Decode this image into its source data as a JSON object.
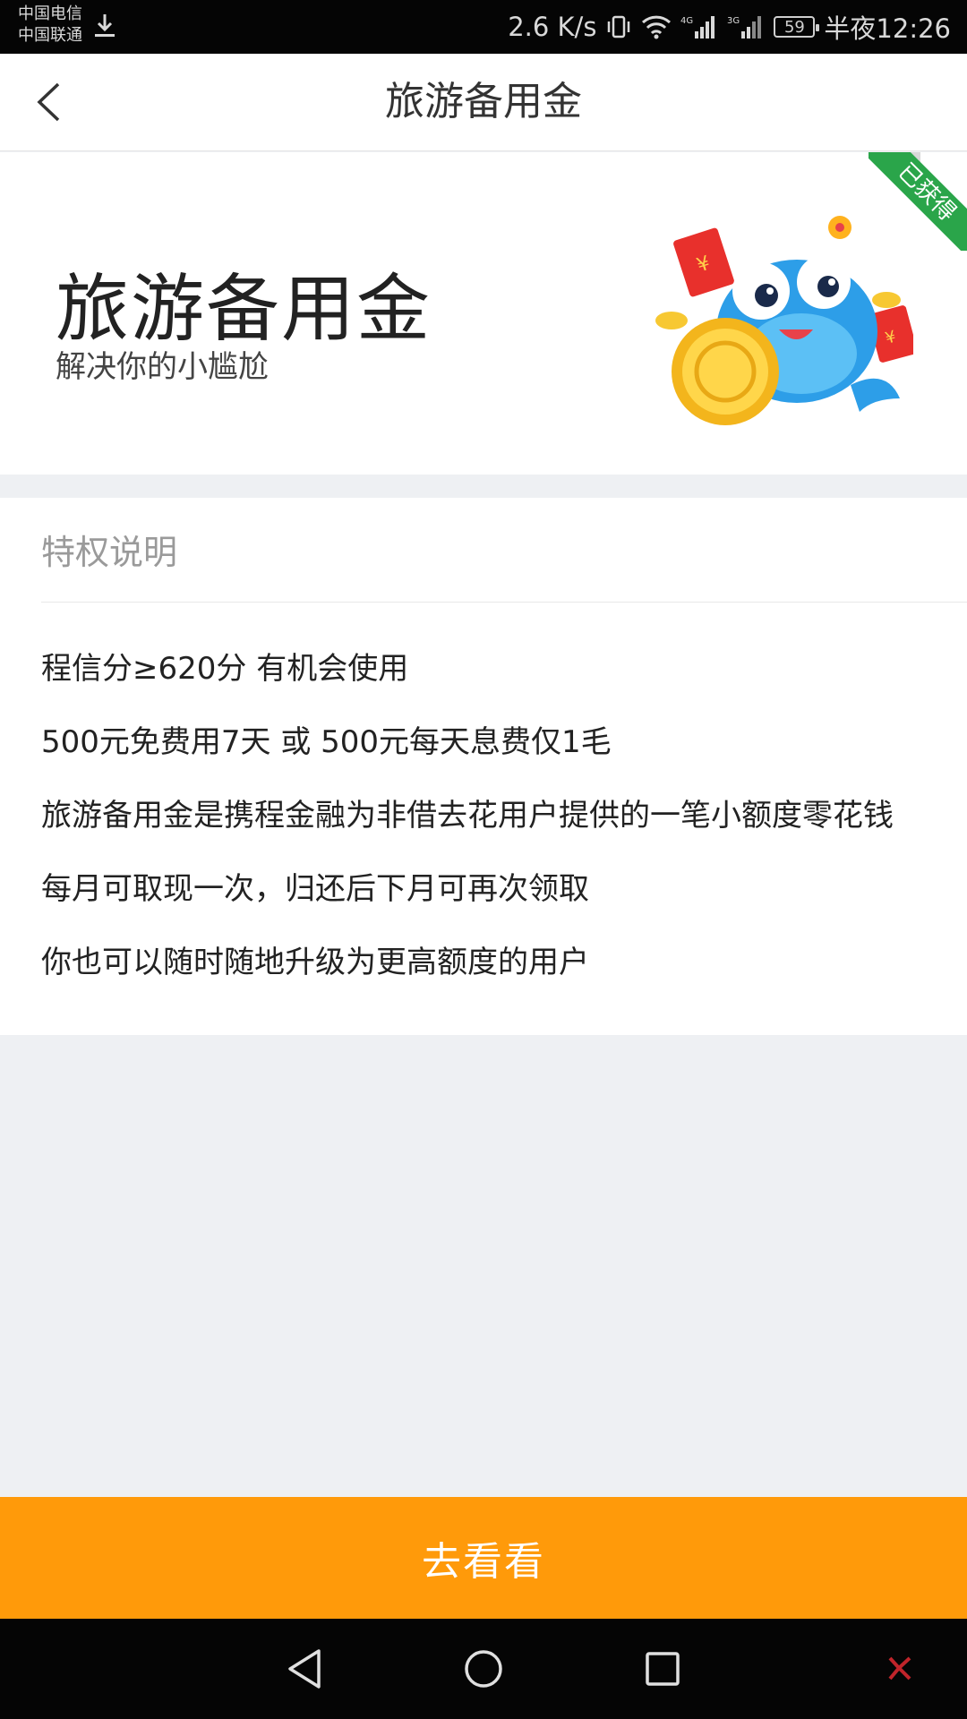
{
  "status_bar": {
    "carrier_1": "中国电信",
    "carrier_2": "中国联通",
    "network_speed": "2.6 K/s",
    "battery": "59",
    "time": "半夜12:26"
  },
  "header": {
    "title": "旅游备用金"
  },
  "banner": {
    "title": "旅游备用金",
    "subtitle": "解决你的小尴尬",
    "ribbon_label": "已获得"
  },
  "privilege": {
    "heading": "特权说明",
    "items": [
      "程信分≥620分 有机会使用",
      "500元免费用7天 或 500元每天息费仅1毛",
      "旅游备用金是携程金融为非借去花用户提供的一笔小额度零花钱",
      "每月可取现一次，归还后下月可再次领取",
      "你也可以随时随地升级为更高额度的用户"
    ]
  },
  "action": {
    "button_label": "去看看"
  },
  "colors": {
    "accent": "#ff9a0a",
    "ribbon": "#2aa54a",
    "page_background": "#eef0f3"
  }
}
